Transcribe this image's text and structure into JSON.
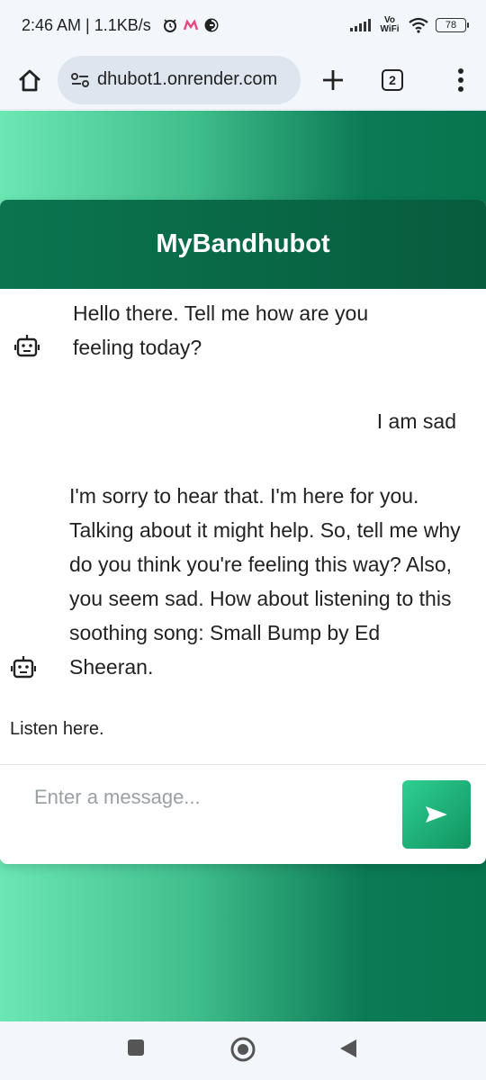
{
  "status_bar": {
    "time_speed": "2:46 AM | 1.1KB/s",
    "network": "Vo WiFi",
    "battery": "78",
    "icons": [
      "alarm-icon",
      "m-app-icon",
      "messenger-icon",
      "signal-icon",
      "wifi-icon",
      "battery-icon"
    ]
  },
  "browser": {
    "url": "dhubot1.onrender.com",
    "tab_count": "2",
    "icons": [
      "home-icon",
      "site-info-icon",
      "new-tab-icon",
      "tabs-icon",
      "more-menu-icon"
    ]
  },
  "chat": {
    "title": "MyBandhubot",
    "messages": [
      {
        "sender": "bot",
        "text": "Hello there. Tell me how are you feeling today?"
      },
      {
        "sender": "user",
        "text": "I am sad"
      },
      {
        "sender": "bot",
        "text": "I'm sorry to hear that. I'm here for you. Talking about it might help. So, tell me why do you think you're feeling this way? Also, you seem sad. How about listening to this soothing song: Small Bump by Ed Sheeran."
      }
    ],
    "listen_link": "Listen here.",
    "input_placeholder": "Enter a message...",
    "input_value": ""
  },
  "colors": {
    "header_green": "#0b7550",
    "send_green": "#2ecf93",
    "bg_gradient_light": "#6ce7b4",
    "bg_gradient_dark": "#07764f"
  },
  "nav": {
    "icons": [
      "recents-icon",
      "home-circle-icon",
      "back-icon"
    ]
  }
}
